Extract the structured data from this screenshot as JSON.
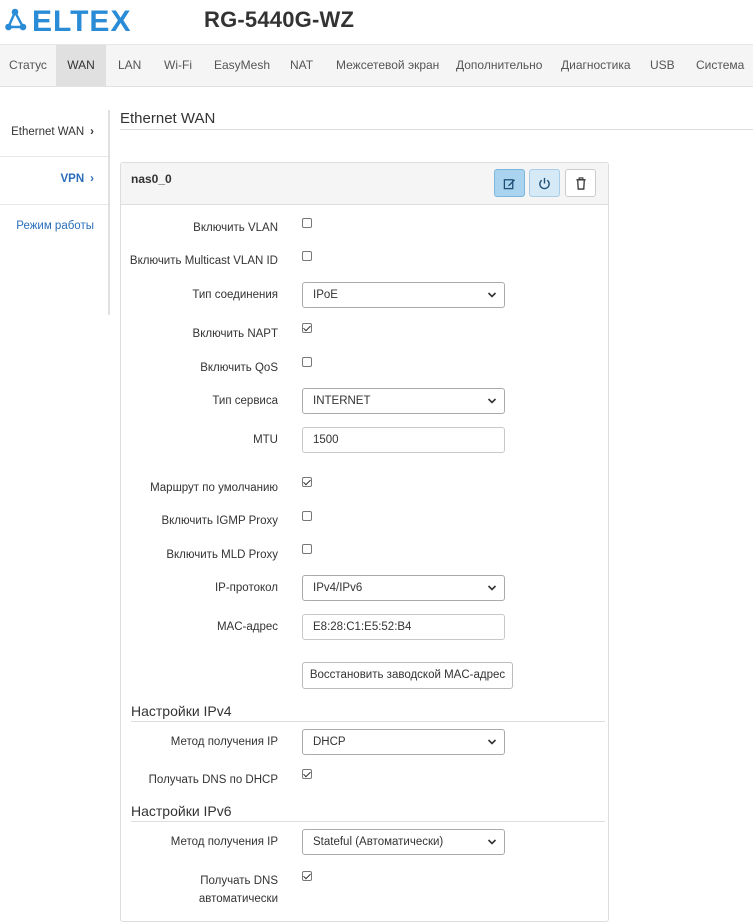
{
  "header": {
    "model": "RG-5440G-WZ",
    "brand_color": "#2a8bd6"
  },
  "nav": {
    "items": [
      "Статус",
      "WAN",
      "LAN",
      "Wi-Fi",
      "EasyMesh",
      "NAT",
      "Межсетевой экран",
      "Дополнительно",
      "Диагностика",
      "USB",
      "Система"
    ],
    "active": "WAN"
  },
  "sidebar": {
    "items": [
      {
        "label": "Ethernet WAN",
        "color": "#333333"
      },
      {
        "label": "VPN",
        "color": "#2a6ebb"
      },
      {
        "label": "Режим работы",
        "color": "#2a6ebb"
      }
    ]
  },
  "section": {
    "title": "Ethernet WAN"
  },
  "panel": {
    "title": "nas0_0",
    "buttons": [
      "edit-icon",
      "power-icon",
      "trash-icon"
    ]
  },
  "form": {
    "enable_vlan": {
      "label": "Включить VLAN",
      "checked": false
    },
    "enable_multicast_vlan": {
      "label": "Включить Multicast VLAN ID",
      "checked": false
    },
    "connection_type": {
      "label": "Тип соединения",
      "value": "IPoE"
    },
    "enable_napt": {
      "label": "Включить NAPT",
      "checked": true
    },
    "enable_qos": {
      "label": "Включить QoS",
      "checked": false
    },
    "service_type": {
      "label": "Тип сервиса",
      "value": "INTERNET"
    },
    "mtu": {
      "label": "MTU",
      "value": "1500"
    },
    "default_route": {
      "label": "Маршрут по умолчанию",
      "checked": true
    },
    "igmp_proxy": {
      "label": "Включить IGMP Proxy",
      "checked": false
    },
    "mld_proxy": {
      "label": "Включить MLD Proxy",
      "checked": false
    },
    "ip_protocol": {
      "label": "IP-протокол",
      "value": "IPv4/IPv6"
    },
    "mac": {
      "label": "MAC-адрес",
      "value": "E8:28:C1:E5:52:B4"
    },
    "restore_mac_button": "Восстановить заводской MAC-адрес"
  },
  "ipv4": {
    "title": "Настройки IPv4",
    "method": {
      "label": "Метод получения IP",
      "value": "DHCP"
    },
    "dns_dhcp": {
      "label": "Получать DNS по DHCP",
      "checked": true
    }
  },
  "ipv6": {
    "title": "Настройки IPv6",
    "method": {
      "label": "Метод получения IP",
      "value": "Stateful (Автоматически)"
    },
    "dns_auto": {
      "label_line1": "Получать DNS",
      "label_line2": "автоматически",
      "checked": true
    }
  }
}
